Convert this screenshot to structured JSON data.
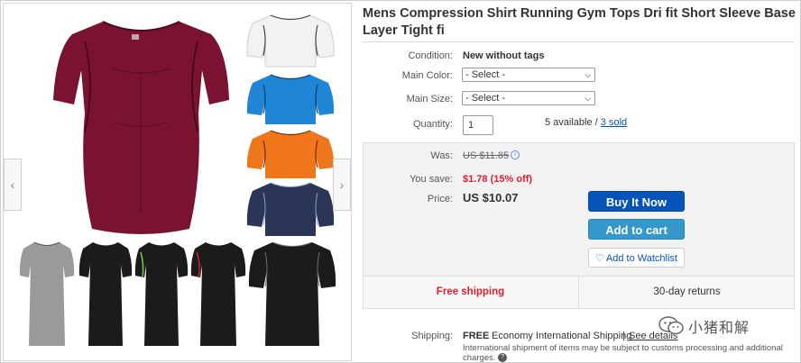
{
  "product": {
    "title": "Mens Compression Shirt Running Gym Tops Dri fit Short Sleeve Base Layer Tight fi"
  },
  "fields": {
    "condition_label": "Condition:",
    "condition_value": "New without tags",
    "color_label": "Main Color:",
    "color_selected": "- Select -",
    "size_label": "Main Size:",
    "size_selected": "- Select -",
    "quantity_label": "Quantity:",
    "quantity_value": "1",
    "available_text": "5 available /",
    "sold_link": "3 sold"
  },
  "pricing": {
    "was_label": "Was:",
    "was_value": "US $11.85",
    "save_label": "You save:",
    "save_value": "$1.78 (15% off)",
    "price_label": "Price:",
    "price_value": "US $10.07"
  },
  "actions": {
    "buy_now": "Buy It Now",
    "add_to_cart": "Add to cart",
    "watchlist": "Add to Watchlist"
  },
  "perks": {
    "free_shipping": "Free shipping",
    "returns": "30-day returns"
  },
  "shipping": {
    "label": "Shipping:",
    "free": "FREE",
    "method": "Economy International Shipping",
    "separator": "|",
    "details_link": "See details",
    "note": "International shipment of items may be subject to customs processing and additional charges."
  },
  "watermark": {
    "text": "小猪和解"
  },
  "colors": {
    "buy_button": "#0654ba",
    "cart_button": "#3498ca",
    "save_red": "#dd1e31",
    "main_shirt": "#7a1232",
    "swatch_white": "#f2f2f2",
    "swatch_blue": "#1f86d6",
    "swatch_orange": "#f0761c",
    "swatch_navy": "#2b3556",
    "swatch_gray": "#9a9a9a",
    "swatch_black": "#1b1b1d"
  },
  "icons": {
    "gallery_prev": "chevron-left-icon",
    "gallery_next": "chevron-right-icon",
    "select_caret": "chevron-down-icon",
    "watch_heart": "heart-icon",
    "info": "info-icon",
    "help": "help-icon"
  }
}
